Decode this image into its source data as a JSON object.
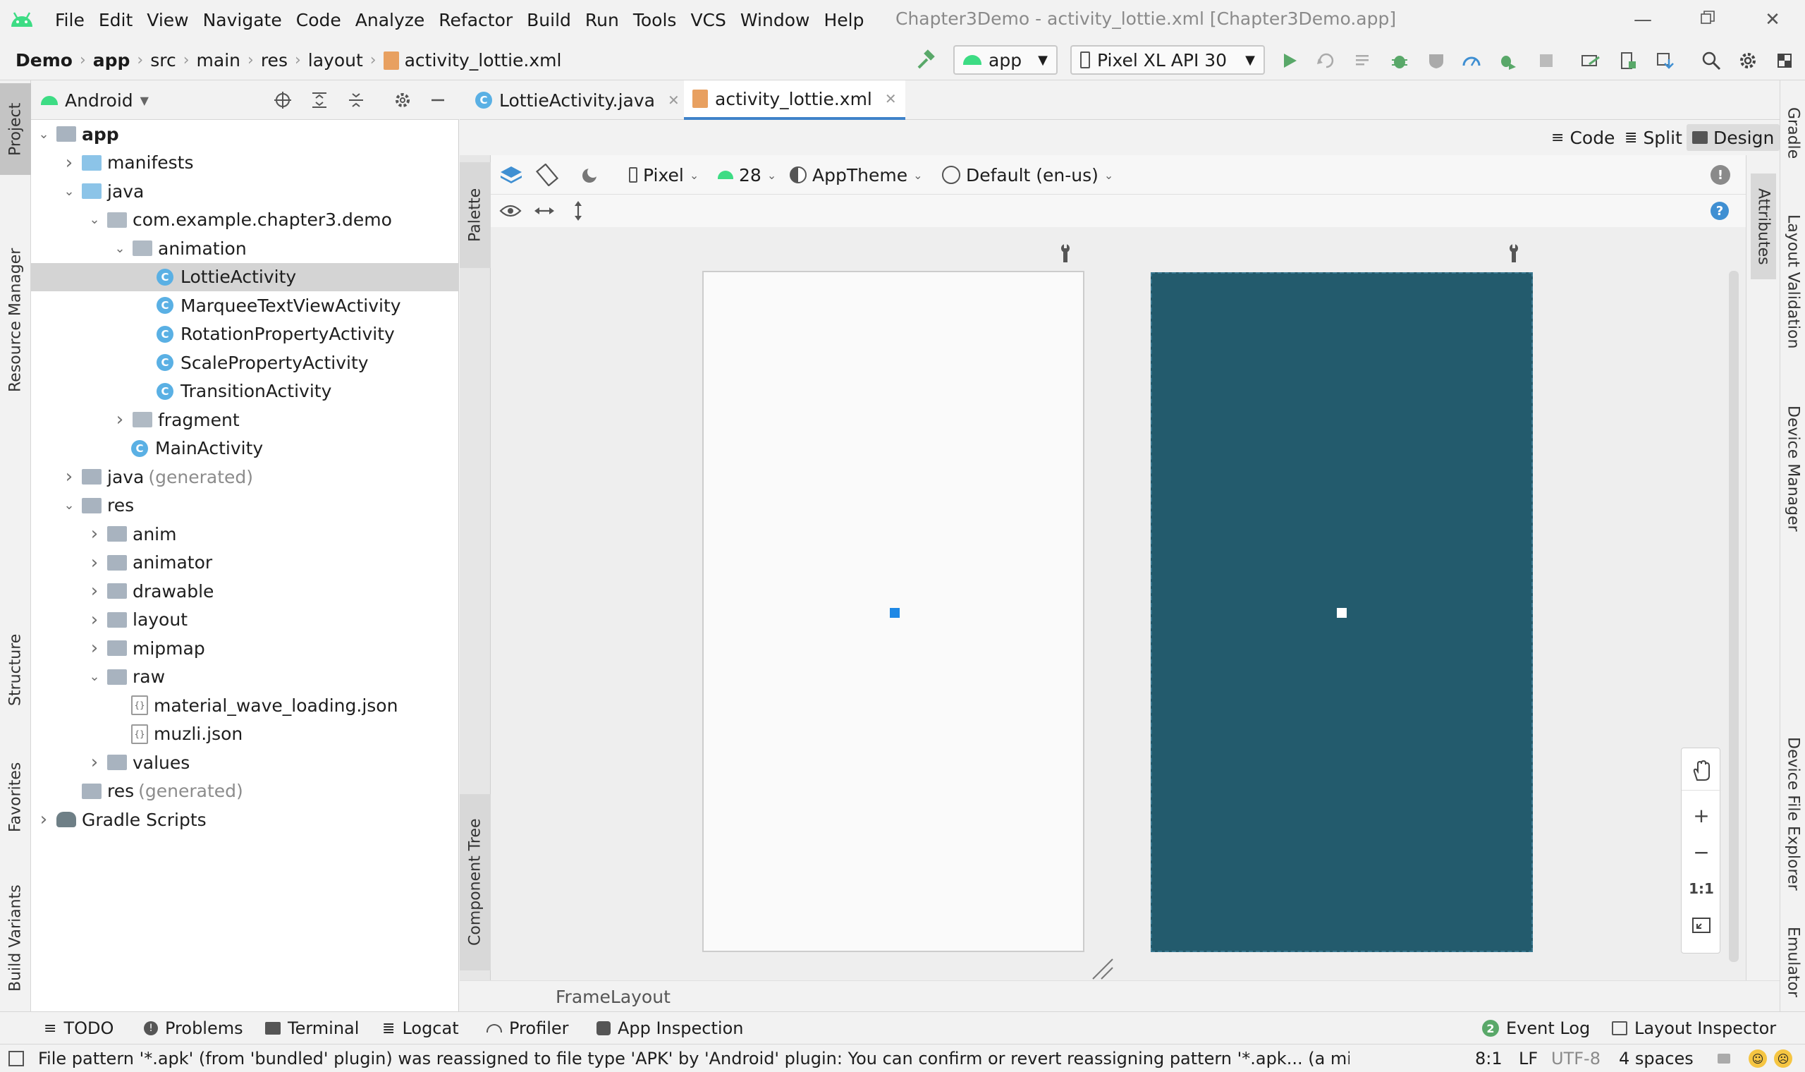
{
  "menu": {
    "items": [
      "File",
      "Edit",
      "View",
      "Navigate",
      "Code",
      "Analyze",
      "Refactor",
      "Build",
      "Run",
      "Tools",
      "VCS",
      "Window",
      "Help"
    ],
    "window_title": "Chapter3Demo - activity_lottie.xml [Chapter3Demo.app]"
  },
  "breadcrumb": [
    "Demo",
    "app",
    "src",
    "main",
    "res",
    "layout",
    "activity_lottie.xml"
  ],
  "toolbar": {
    "run_config": "app",
    "device": "Pixel XL API 30"
  },
  "left_tabs": [
    "Project",
    "Resource Manager",
    "Structure",
    "Favorites",
    "Build Variants"
  ],
  "project": {
    "view_selector": "Android",
    "tree": [
      {
        "label": "app",
        "depth": 0,
        "expanded": true,
        "icon": "folder-gray"
      },
      {
        "label": "manifests",
        "depth": 1,
        "expanded": false,
        "icon": "folder-blue"
      },
      {
        "label": "java",
        "depth": 1,
        "expanded": true,
        "icon": "folder-blue"
      },
      {
        "label": "com.example.chapter3.demo",
        "depth": 2,
        "expanded": true,
        "icon": "package"
      },
      {
        "label": "animation",
        "depth": 3,
        "expanded": true,
        "icon": "package"
      },
      {
        "label": "LottieActivity",
        "depth": 4,
        "icon": "class",
        "selected": true
      },
      {
        "label": "MarqueeTextViewActivity",
        "depth": 4,
        "icon": "class"
      },
      {
        "label": "RotationPropertyActivity",
        "depth": 4,
        "icon": "class"
      },
      {
        "label": "ScalePropertyActivity",
        "depth": 4,
        "icon": "class"
      },
      {
        "label": "TransitionActivity",
        "depth": 4,
        "icon": "class"
      },
      {
        "label": "fragment",
        "depth": 3,
        "expanded": false,
        "icon": "package"
      },
      {
        "label": "MainActivity",
        "depth": 3,
        "icon": "class"
      },
      {
        "label": "java",
        "suffix": "(generated)",
        "depth": 1,
        "expanded": false,
        "icon": "folder-gray"
      },
      {
        "label": "res",
        "depth": 1,
        "expanded": true,
        "icon": "folder-gray"
      },
      {
        "label": "anim",
        "depth": 2,
        "expanded": false,
        "icon": "folder-gray"
      },
      {
        "label": "animator",
        "depth": 2,
        "expanded": false,
        "icon": "folder-gray"
      },
      {
        "label": "drawable",
        "depth": 2,
        "expanded": false,
        "icon": "folder-gray"
      },
      {
        "label": "layout",
        "depth": 2,
        "expanded": false,
        "icon": "folder-gray"
      },
      {
        "label": "mipmap",
        "depth": 2,
        "expanded": false,
        "icon": "folder-gray"
      },
      {
        "label": "raw",
        "depth": 2,
        "expanded": true,
        "icon": "folder-gray"
      },
      {
        "label": "material_wave_loading.json",
        "depth": 3,
        "icon": "json"
      },
      {
        "label": "muzli.json",
        "depth": 3,
        "icon": "json"
      },
      {
        "label": "values",
        "depth": 2,
        "expanded": false,
        "icon": "folder-gray"
      },
      {
        "label": "res",
        "suffix": "(generated)",
        "depth": 1,
        "icon": "folder-gray"
      },
      {
        "label": "Gradle Scripts",
        "depth": 0,
        "expanded": false,
        "icon": "gradle"
      }
    ]
  },
  "editor_tabs": [
    {
      "label": "LottieActivity.java",
      "active": false
    },
    {
      "label": "activity_lottie.xml",
      "active": true
    }
  ],
  "view_modes": [
    "Code",
    "Split",
    "Design"
  ],
  "design_toolbar": {
    "device": "Pixel",
    "api": "28",
    "theme": "AppTheme",
    "locale": "Default (en-us)"
  },
  "palette_tab": "Palette",
  "component_tree_tab": "Component Tree",
  "attributes_tab": "Attributes",
  "right_tabs": [
    "Gradle",
    "Layout Validation",
    "Device Manager",
    "Device File Explorer",
    "Emulator"
  ],
  "zoom": {
    "fit_label": "1:1"
  },
  "frame_label": "FrameLayout",
  "bottom_tools": [
    "TODO",
    "Problems",
    "Terminal",
    "Logcat",
    "Profiler",
    "App Inspection"
  ],
  "bottom_right_tools": {
    "event_log_count": "2",
    "event_log": "Event Log",
    "layout_inspector": "Layout Inspector"
  },
  "status": {
    "message": "File pattern '*.apk' (from 'bundled' plugin) was reassigned to file type 'APK' by 'Android' plugin: You can confirm or revert reassigning pattern '*.apk... (a minute ago)",
    "position": "8:1",
    "line_sep": "LF",
    "encoding": "UTF-8",
    "indent": "4 spaces"
  },
  "colors": {
    "accent": "#4083c9",
    "blueprint": "#235b6d",
    "android_green": "#3ddc84",
    "run_green": "#59a869"
  }
}
